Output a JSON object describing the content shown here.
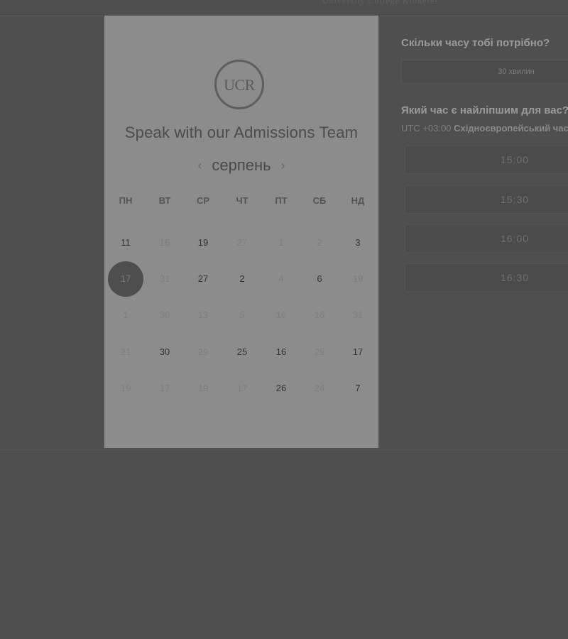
{
  "header": {
    "brand_text": "University College Kinneret"
  },
  "card": {
    "logo_text": "UCR",
    "title": "Speak with our Admissions Team",
    "month": "серпень",
    "prev_arrow": "‹",
    "next_arrow": "›",
    "weekdays": [
      "ПН",
      "ВТ",
      "СР",
      "ЧТ",
      "ПТ",
      "СБ",
      "НД"
    ],
    "weeks": [
      [
        {
          "d": "11",
          "a": true
        },
        {
          "d": "16",
          "a": false
        },
        {
          "d": "19",
          "a": true
        },
        {
          "d": "27",
          "a": false
        },
        {
          "d": "1",
          "a": false
        },
        {
          "d": "2",
          "a": false
        },
        {
          "d": "3",
          "a": true
        }
      ],
      [
        {
          "d": "17",
          "a": true,
          "sel": true
        },
        {
          "d": "31",
          "a": false
        },
        {
          "d": "27",
          "a": true
        },
        {
          "d": "2",
          "a": true
        },
        {
          "d": "4",
          "a": false
        },
        {
          "d": "6",
          "a": true
        },
        {
          "d": "19",
          "a": false
        }
      ],
      [
        {
          "d": "1",
          "a": false
        },
        {
          "d": "30",
          "a": false
        },
        {
          "d": "13",
          "a": false
        },
        {
          "d": "5",
          "a": false
        },
        {
          "d": "16",
          "a": false
        },
        {
          "d": "16",
          "a": false
        },
        {
          "d": "31",
          "a": false
        }
      ],
      [
        {
          "d": "21",
          "a": false
        },
        {
          "d": "30",
          "a": true
        },
        {
          "d": "29",
          "a": false
        },
        {
          "d": "25",
          "a": true
        },
        {
          "d": "16",
          "a": true
        },
        {
          "d": "25",
          "a": false
        },
        {
          "d": "17",
          "a": true
        }
      ],
      [
        {
          "d": "19",
          "a": false
        },
        {
          "d": "17",
          "a": false
        },
        {
          "d": "19",
          "a": false
        },
        {
          "d": "17",
          "a": false
        },
        {
          "d": "26",
          "a": true
        },
        {
          "d": "24",
          "a": false
        },
        {
          "d": "7",
          "a": true
        }
      ]
    ]
  },
  "right": {
    "duration_question": "Скільки часу тобі потрібно?",
    "duration_value": "30 хвилин",
    "time_question": "Який час є найліпшим для вас?",
    "tz_offset": "UTC +03:00",
    "tz_name": "Східноєвропейський час",
    "slots": [
      "15:00",
      "15:30",
      "16:00",
      "16:30"
    ]
  }
}
